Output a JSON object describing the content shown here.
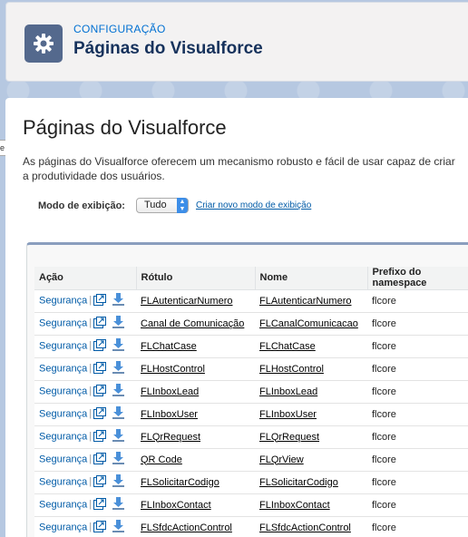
{
  "header": {
    "eyebrow": "CONFIGURAÇÃO",
    "title": "Páginas do Visualforce",
    "icon": "gear-icon"
  },
  "page": {
    "title": "Páginas do Visualforce",
    "description_line1": "As páginas do Visualforce oferecem um mecanismo robusto e fácil de usar capaz de criar",
    "description_line2": "a produtividade dos usuários."
  },
  "view": {
    "label": "Modo de exibição:",
    "selected": "Tudo",
    "create_link": "Criar novo modo de exibição"
  },
  "table": {
    "columns": [
      "Ação",
      "Rótulo",
      "Nome",
      "Prefixo do namespace"
    ],
    "action_label": "Segurança",
    "rows": [
      {
        "label": "FLAutenticarNumero",
        "name": "FLAutenticarNumero",
        "prefix": "flcore"
      },
      {
        "label": "Canal de Comunicação",
        "name": "FLCanalComunicacao",
        "prefix": "flcore"
      },
      {
        "label": "FLChatCase",
        "name": "FLChatCase",
        "prefix": "flcore"
      },
      {
        "label": "FLHostControl",
        "name": "FLHostControl",
        "prefix": "flcore"
      },
      {
        "label": "FLInboxLead",
        "name": "FLInboxLead",
        "prefix": "flcore"
      },
      {
        "label": "FLInboxUser",
        "name": "FLInboxUser",
        "prefix": "flcore"
      },
      {
        "label": "FLQrRequest",
        "name": "FLQrRequest",
        "prefix": "flcore"
      },
      {
        "label": "QR Code",
        "name": "FLQrView",
        "prefix": "flcore"
      },
      {
        "label": "FLSolicitarCodigo",
        "name": "FLSolicitarCodigo",
        "prefix": "flcore"
      },
      {
        "label": "FLInboxContact",
        "name": "FLInboxContact",
        "prefix": "flcore"
      },
      {
        "label": "FLSfdcActionControl",
        "name": "FLSfdcActionControl",
        "prefix": "flcore"
      }
    ]
  },
  "colors": {
    "accent": "#0070d2",
    "link": "#015ba7",
    "header_icon_bg": "#54698d"
  }
}
